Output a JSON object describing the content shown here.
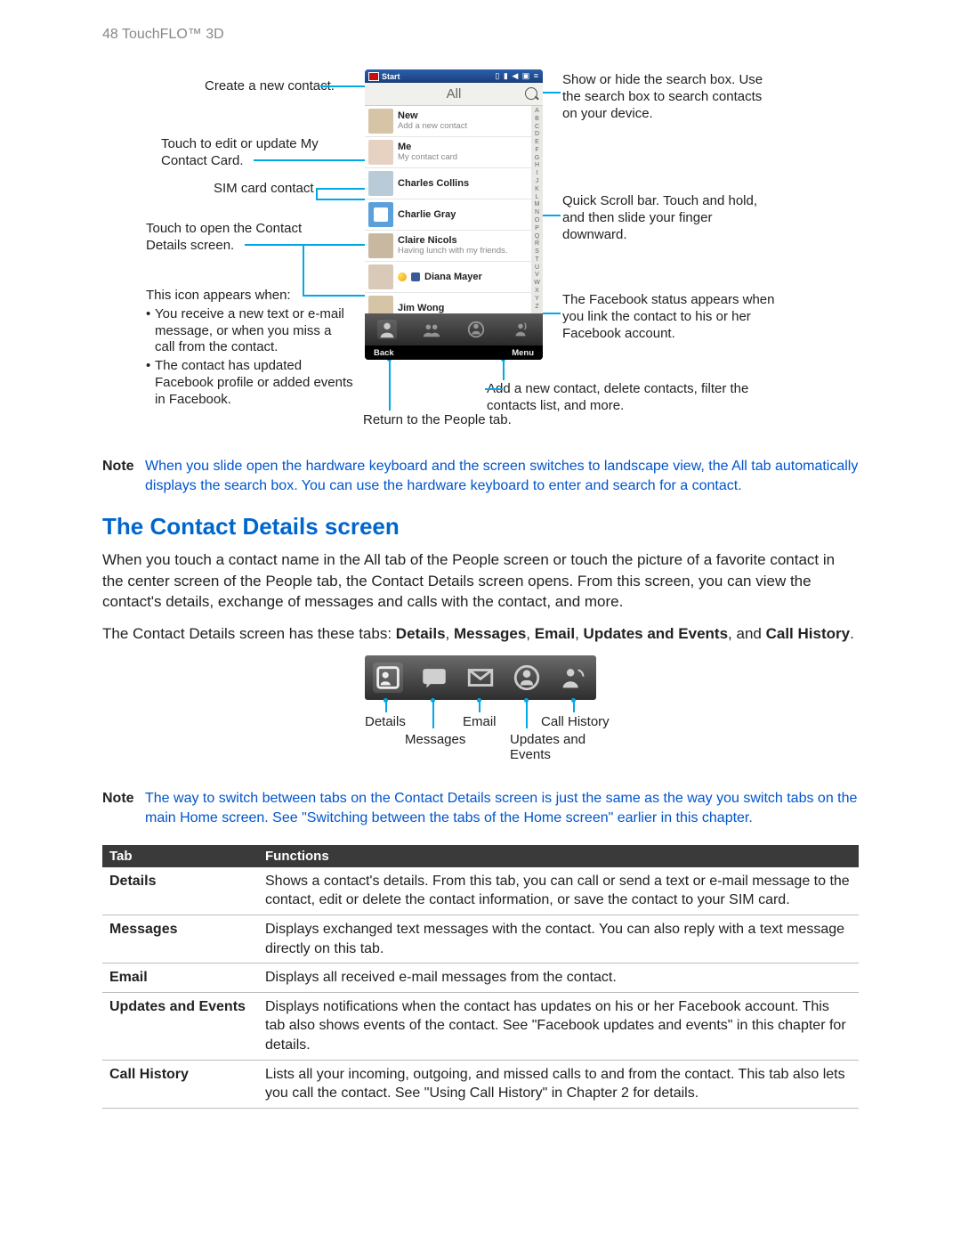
{
  "page_header": "48  TouchFLO™ 3D",
  "callouts": {
    "l1": "Create a new contact.",
    "l2a": "Touch to edit or update My",
    "l2b": "Contact Card.",
    "l3": "SIM card contact",
    "l4a": "Touch to open the Contact",
    "l4b": "Details screen.",
    "l5": "This icon appears when:",
    "l5i1": "You receive a new text or e-mail message, or when you miss a call from the contact.",
    "l5i2": "The contact has updated Facebook profile or added events in Facebook.",
    "r1": "Show or hide the search box. Use the search box to search contacts on your device.",
    "r2": "Quick Scroll bar. Touch and hold, and then slide your finger downward.",
    "r3": "The Facebook status appears when you link the contact to his or her Facebook account.",
    "b1": "Return to the People tab.",
    "b2": "Add a new contact, delete contacts, filter the contacts list, and more."
  },
  "phone": {
    "start": "Start",
    "status_icons": "▯ ▮ ◀ ▣ ≡",
    "all": "All",
    "new": {
      "title": "New",
      "sub": "Add a new contact"
    },
    "me": {
      "title": "Me",
      "sub": "My contact card"
    },
    "c1": {
      "title": "Charles Collins"
    },
    "c2": {
      "title": "Charlie Gray"
    },
    "c3": {
      "title": "Claire Nicols",
      "sub": "Having lunch with my friends."
    },
    "c4": {
      "title": "Diana Mayer"
    },
    "c5": {
      "title": "Jim Wong"
    },
    "back": "Back",
    "menu": "Menu",
    "index": "ABCDEFGHIJKLMNOPQRSTUVWXYZ"
  },
  "note1": "When you slide open the hardware keyboard and the screen switches to landscape view, the All tab automatically displays the search box. You can use the hardware keyboard to enter and search for a contact.",
  "section_title": "The Contact Details screen",
  "para1": "When you touch a contact name in the All tab of the People screen or touch the picture of a favorite contact in the center screen of the People tab, the Contact Details screen opens. From this screen, you can view the contact's details, exchange of messages and calls with the contact, and more.",
  "para2_pre": "The Contact Details screen has these tabs: ",
  "para2_b1": "Details",
  "para2_s1": ", ",
  "para2_b2": "Messages",
  "para2_s2": ", ",
  "para2_b3": "Email",
  "para2_s3": ", ",
  "para2_b4": "Updates and Events",
  "para2_s4": ", and ",
  "para2_b5": "Call History",
  "para2_end": ".",
  "tabs": {
    "details": "Details",
    "messages": "Messages",
    "email": "Email",
    "updates": "Updates and\nEvents",
    "history": "Call History"
  },
  "note2": "The way to switch between tabs on the Contact Details screen is just the same as the way you switch tabs on the main Home screen. See \"Switching between the tabs of the Home screen\" earlier in this chapter.",
  "table": {
    "head_tab": "Tab",
    "head_fn": "Functions",
    "rows": {
      "details": {
        "t": "Details",
        "f": "Shows a contact's details. From this tab, you can call or send a text or e-mail message to the contact, edit or delete the contact information, or save the contact to your SIM card."
      },
      "messages": {
        "t": "Messages",
        "f": "Displays exchanged text messages with the contact. You can also reply with a text message directly on this tab."
      },
      "email": {
        "t": "Email",
        "f": "Displays all received e-mail messages from the contact."
      },
      "updates": {
        "t": "Updates and Events",
        "f": "Displays notifications when the contact has updates on his or her Facebook account. This tab also shows events of the contact. See \"Facebook updates and events\" in this chapter for details."
      },
      "history": {
        "t": "Call History",
        "f": "Lists all your incoming, outgoing, and missed calls to and from the contact. This tab also lets you call the contact. See \"Using Call History\" in Chapter 2 for details."
      }
    }
  },
  "note_label": "Note"
}
